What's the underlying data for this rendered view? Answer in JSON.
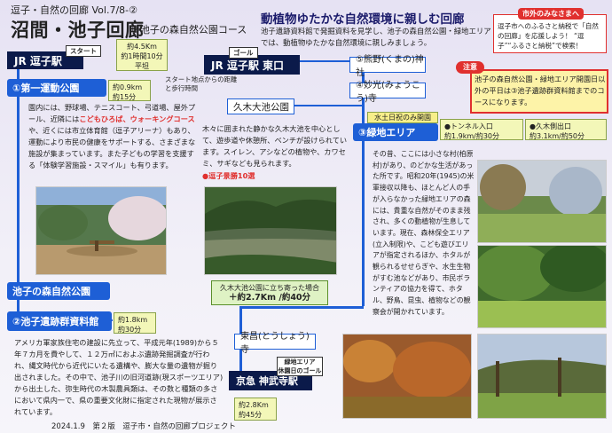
{
  "header": {
    "series": "逗子・自然の回廊 Vol.7/8-②",
    "title": "沼間・池子回廊",
    "subtitle": "②池子の森自然公園コース",
    "headline": "動植物ゆたかな自然環境に親しむ回廊",
    "intro": "池子遺跡資料館で発掘資料を見学し、池子の森自然公園・緑地エリアでは、動植物ゆたかな自然環境に親しみましょう。"
  },
  "hometax": {
    "label": "市外のみなさまへ",
    "text": "逗子市へのふるさと納税で「自然の回廊」を応援しよう！ “逗子”“ふるさと納税”で検索！"
  },
  "notice": {
    "label": "注意",
    "text": "池子の森自然公園・緑地エリア開園日以外の平日は③池子遺跡群資料館までのコースになります。"
  },
  "route": {
    "start_tag": "スタート",
    "goal_tag": "ゴール",
    "start_station": "JR 逗子駅",
    "goal_station": "JR 逗子駅 東口",
    "total_distance": "約4.5Km",
    "total_time": "約1時間10分",
    "difficulty": "平坦",
    "legend": "スタート地点からの距離と歩行時間",
    "stop1_label": "①第一運動公園",
    "stop1_dist": "約0.9km",
    "stop1_time": "約15分",
    "stop1_text_a": "園内には、野球場、テニスコート、弓道場、屋外プール、近隣には",
    "stop1_text_red": "こどもひろば、ウォーキングコース",
    "stop1_text_b": "や、近くには市立体育館（逗子アリーナ）もあり、運動により市民の健康をサポートする、さまざまな施設が集まっています。また子どもの学習を支援する「体験学習施設・スマイル」も有ります。",
    "park_label": "池子の森自然公園",
    "stop2_label": "②池子遺跡群資料館",
    "stop2_dist": "約1.8km",
    "stop2_time": "約30分",
    "stop2_text": "アメリカ軍家族住宅の建設に先立って、平成元年(1989)から５年７カ月を費やして、１２万㎡におよぶ遺跡発掘調査が行われ、縄文時代から近代にいたる遺構や、膨大な量の遺物が掘り出されました。その中で、池子川の旧河道跡(現スポーツエリア)から出土した、弥生時代の木製農具類は、その数と種類の多さにおいて県内一で、県の重要文化財に指定された現物が展示されています。",
    "stop3_label": "③緑地エリア",
    "stop3_open": "水土日祝のみ開園",
    "stop3_tunnel_in": "●トンネル入口",
    "stop3_tunnel_in_dist": "約1.9km/約30分",
    "stop3_park_exit": "●久木側出口",
    "stop3_park_exit_dist": "約3.1km/約50分",
    "stop3_text": "その昔、ここには小さな村(柏原村)があり、のどかな生活があった所です。昭和20年(1945)の米軍接収以降も、ほとんど人の手が入らなかった緑地エリアの森には、貴重な自然がそのまま残され、多くの動植物が生息しています。現在、森林保全エリア(立入制限)や、こども遊びエリアが指定されるほか、ホタルが観られるせせらぎや、水生生物がすむ池などがあり、市民ボランティアの協力を得て、ホタル、野鳥、昆虫、植物などの観察会が開かれています。",
    "lake_label": "久木大池公園",
    "lake_text": "木々に囲まれた静かな久木大池を中心として、遊歩道や休憩所、ベンチが設けられています。スイレン、アシなどの植物や、カワセミ、サギなども見られます。",
    "lake_note": "●逗子景勝10選",
    "lake_detour": "久木大池公園に立ち寄った場合",
    "lake_detour_total": "＋約2.7Km /約40分",
    "stop5_label": "⑤熊野(くまの)神社",
    "stop4_label": "④妙光(みょうこう)寺",
    "tokoji_label": "東昌(とうしょう)寺",
    "keikyu_station": "京急 神武寺駅",
    "keikyu_goal_tag": "緑地エリア\n休園日のゴール",
    "keikyu_dist": "約2.8Km",
    "keikyu_time": "約45分"
  },
  "footer": "2024.1.9　第２版　逗子市・自然の回廊プロジェクト",
  "colors": {
    "route_blue": "#1e5fd6",
    "station_navy": "#0b1a4a",
    "accent_red": "#e0302e"
  }
}
